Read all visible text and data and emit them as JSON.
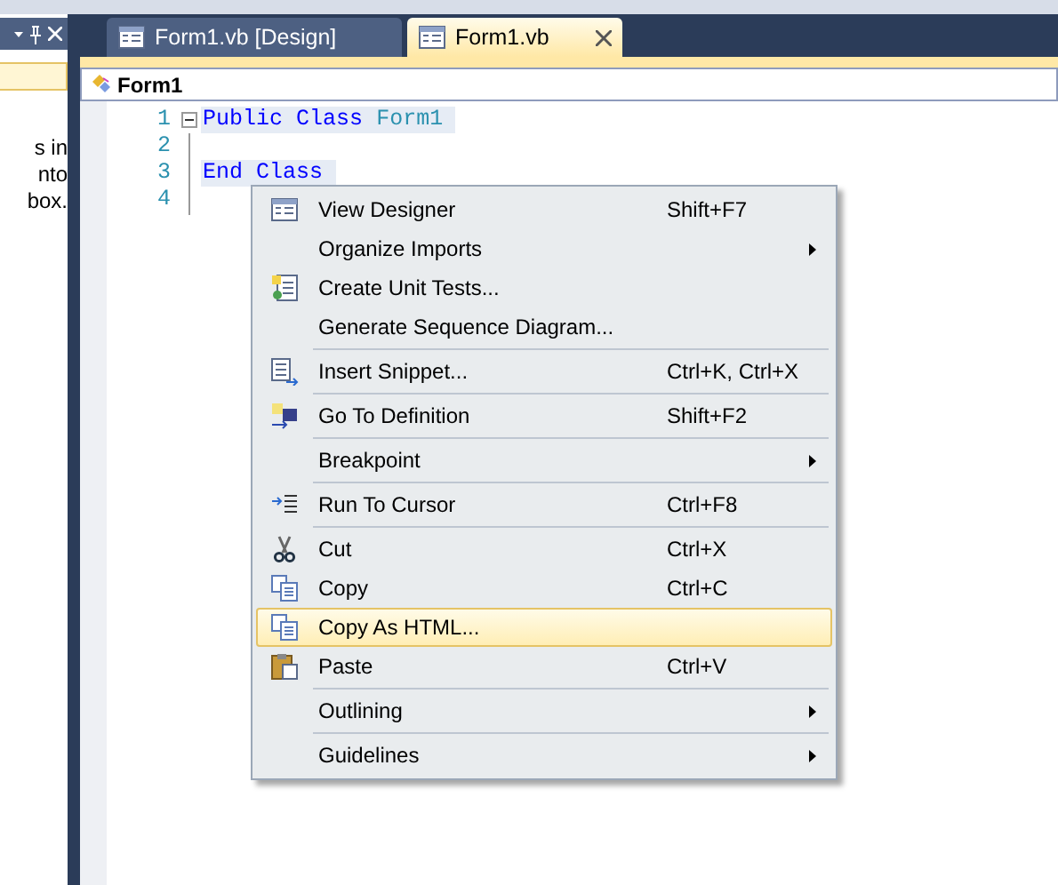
{
  "tool_window": {
    "text_lines": [
      "s in",
      "nto",
      "box."
    ]
  },
  "tabs": [
    {
      "label": "Form1.vb [Design]",
      "selected": false
    },
    {
      "label": "Form1.vb",
      "selected": true
    }
  ],
  "navigation_bar": {
    "label": "Form1"
  },
  "code_lines": [
    {
      "number": "1",
      "expanded": true,
      "tokens": [
        {
          "text": "Public",
          "kind": "keyword"
        },
        {
          "text": "Class",
          "kind": "keyword"
        },
        {
          "text": "Form1",
          "kind": "type"
        }
      ]
    },
    {
      "number": "2"
    },
    {
      "number": "3",
      "tokens": [
        {
          "text": "End",
          "kind": "keyword"
        },
        {
          "text": "Class",
          "kind": "keyword"
        }
      ]
    },
    {
      "number": "4"
    }
  ],
  "context_menu": {
    "groups": [
      {
        "items": [
          {
            "kind": "designer",
            "label": "View Designer",
            "shortcut": "Shift+F7",
            "submenu": false,
            "selected": false
          },
          {
            "label": "Organize Imports",
            "submenu": true,
            "selected": false
          },
          {
            "kind": "unit-tests",
            "label": "Create Unit Tests...",
            "submenu": false,
            "selected": false
          },
          {
            "label": "Generate Sequence Diagram...",
            "submenu": false,
            "selected": false
          }
        ]
      },
      {
        "items": [
          {
            "kind": "snippet",
            "label": "Insert Snippet...",
            "shortcut": "Ctrl+K, Ctrl+X",
            "submenu": false,
            "selected": false
          }
        ]
      },
      {
        "items": [
          {
            "kind": "goto",
            "label": "Go To Definition",
            "shortcut": "Shift+F2",
            "submenu": false,
            "selected": false
          }
        ]
      },
      {
        "items": [
          {
            "label": "Breakpoint",
            "submenu": true,
            "selected": false
          }
        ]
      },
      {
        "items": [
          {
            "kind": "run-cursor",
            "label": "Run To Cursor",
            "shortcut": "Ctrl+F8",
            "submenu": false,
            "selected": false
          }
        ]
      },
      {
        "items": [
          {
            "kind": "cut",
            "label": "Cut",
            "shortcut": "Ctrl+X",
            "submenu": false,
            "selected": false
          },
          {
            "kind": "copy",
            "label": "Copy",
            "shortcut": "Ctrl+C",
            "submenu": false,
            "selected": false
          },
          {
            "kind": "copy",
            "label": "Copy As HTML...",
            "submenu": false,
            "selected": true
          },
          {
            "kind": "paste",
            "label": "Paste",
            "shortcut": "Ctrl+V",
            "submenu": false,
            "selected": false
          }
        ]
      },
      {
        "items": [
          {
            "label": "Outlining",
            "submenu": true,
            "selected": false
          }
        ]
      },
      {
        "items": [
          {
            "label": "Guidelines",
            "submenu": true,
            "selected": false
          }
        ]
      }
    ]
  }
}
